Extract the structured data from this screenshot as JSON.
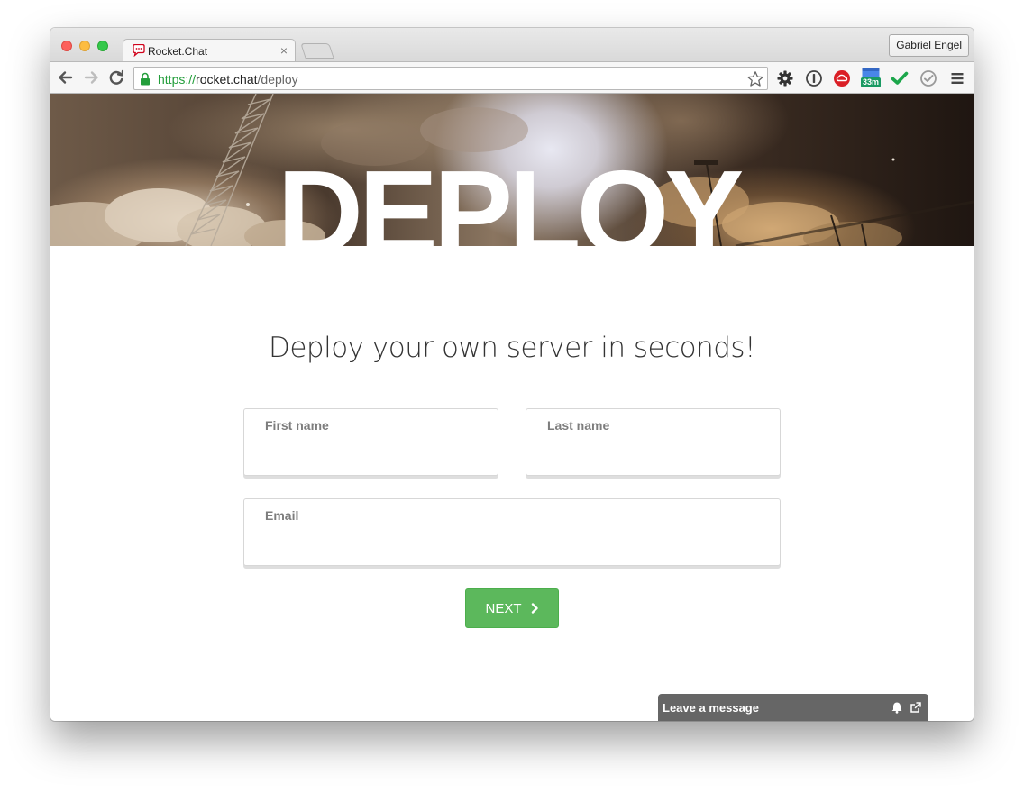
{
  "browser": {
    "tab_title": "Rocket.Chat",
    "tab_close": "×",
    "profile_name": "Gabriel Engel",
    "url_scheme": "https://",
    "url_host": "rocket.chat",
    "url_path": "/deploy",
    "extension_badge": "33m"
  },
  "hero": {
    "title": "DEPLOY"
  },
  "main": {
    "headline": "Deploy your own server in seconds!",
    "first_name_label": "First name",
    "last_name_label": "Last name",
    "email_label": "Email",
    "next_label": "NEXT"
  },
  "livechat": {
    "title": "Leave a message"
  },
  "colors": {
    "button_green": "#5cb85c",
    "secure_green": "#239e3b",
    "livechat_bar": "#666666"
  }
}
